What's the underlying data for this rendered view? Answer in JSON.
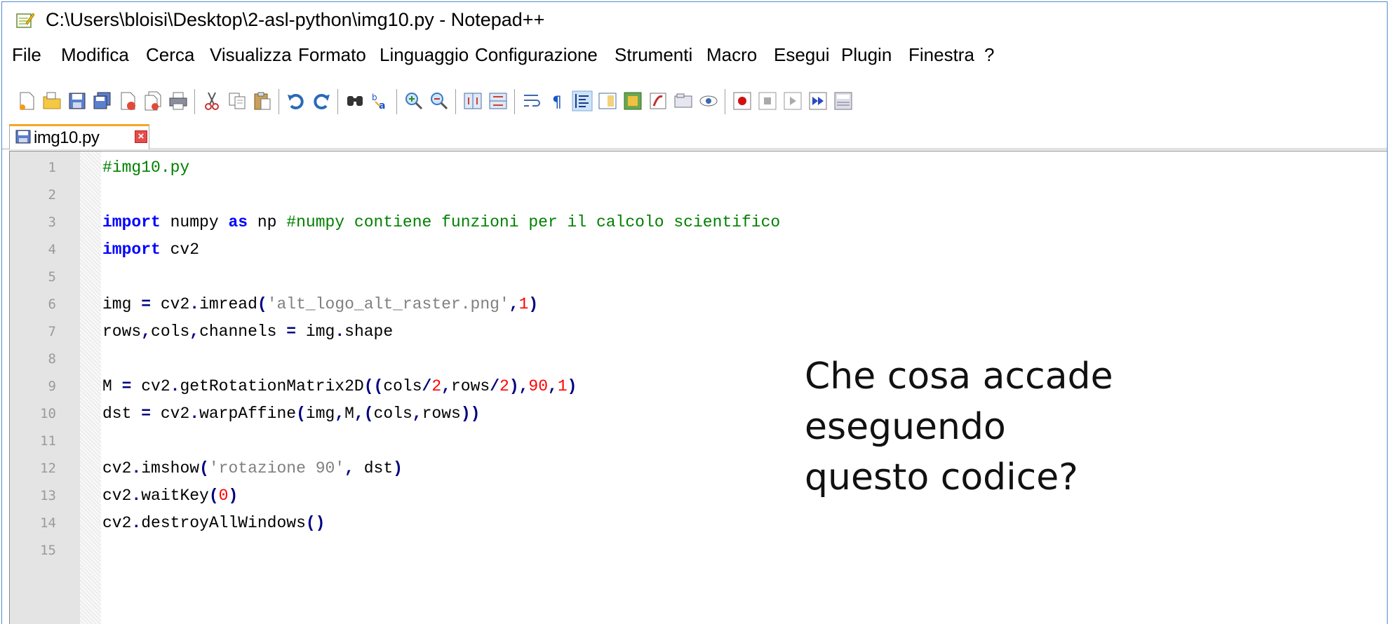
{
  "window": {
    "title": "C:\\Users\\bloisi\\Desktop\\2-asl-python\\img10.py - Notepad++"
  },
  "menu": [
    "File",
    "Modifica",
    "Cerca",
    "Visualizza",
    "Formato",
    "Linguaggio",
    "Configurazione",
    "Strumenti",
    "Macro",
    "Esegui",
    "Plugin",
    "Finestra",
    "?"
  ],
  "toolbar_icons": [
    "new-file-icon",
    "open-file-icon",
    "save-icon",
    "save-all-icon",
    "close-icon",
    "close-all-icon",
    "print-icon",
    "cut-icon",
    "copy-icon",
    "paste-icon",
    "undo-icon",
    "redo-icon",
    "find-icon",
    "replace-icon",
    "zoom-in-icon",
    "zoom-out-icon",
    "sync-vertical-icon",
    "sync-horizontal-icon",
    "word-wrap-icon",
    "show-all-chars-icon",
    "indent-guide-icon",
    "document-map-icon",
    "function-list-icon",
    "folder-workspace-icon",
    "monitoring-icon",
    "record-macro-icon",
    "stop-record-icon",
    "play-macro-icon",
    "run-macro-multiple-icon",
    "save-macro-icon"
  ],
  "tab": {
    "label": "img10.py"
  },
  "editor": {
    "line_numbers": [
      "1",
      "2",
      "3",
      "4",
      "5",
      "6",
      "7",
      "8",
      "9",
      "10",
      "11",
      "12",
      "13",
      "14",
      "15"
    ],
    "lines": [
      [
        {
          "t": "#img10.py",
          "c": "cm"
        }
      ],
      [],
      [
        {
          "t": "import",
          "c": "kw"
        },
        {
          "t": " numpy ",
          "c": ""
        },
        {
          "t": "as",
          "c": "kw"
        },
        {
          "t": " np ",
          "c": ""
        },
        {
          "t": "#numpy contiene funzioni per il calcolo scientifico",
          "c": "cm"
        }
      ],
      [
        {
          "t": "import",
          "c": "kw"
        },
        {
          "t": " cv2",
          "c": ""
        }
      ],
      [],
      [
        {
          "t": "img ",
          "c": ""
        },
        {
          "t": "=",
          "c": "op"
        },
        {
          "t": " cv2",
          "c": ""
        },
        {
          "t": ".",
          "c": "op"
        },
        {
          "t": "imread",
          "c": ""
        },
        {
          "t": "(",
          "c": "op"
        },
        {
          "t": "'alt_logo_alt_raster.png'",
          "c": "st"
        },
        {
          "t": ",",
          "c": "op"
        },
        {
          "t": "1",
          "c": "nm"
        },
        {
          "t": ")",
          "c": "op"
        }
      ],
      [
        {
          "t": "rows",
          "c": ""
        },
        {
          "t": ",",
          "c": "op"
        },
        {
          "t": "cols",
          "c": ""
        },
        {
          "t": ",",
          "c": "op"
        },
        {
          "t": "channels ",
          "c": ""
        },
        {
          "t": "=",
          "c": "op"
        },
        {
          "t": " img",
          "c": ""
        },
        {
          "t": ".",
          "c": "op"
        },
        {
          "t": "shape",
          "c": ""
        }
      ],
      [],
      [
        {
          "t": "M ",
          "c": ""
        },
        {
          "t": "=",
          "c": "op"
        },
        {
          "t": " cv2",
          "c": ""
        },
        {
          "t": ".",
          "c": "op"
        },
        {
          "t": "getRotationMatrix2D",
          "c": ""
        },
        {
          "t": "((",
          "c": "op"
        },
        {
          "t": "cols",
          "c": ""
        },
        {
          "t": "/",
          "c": "op"
        },
        {
          "t": "2",
          "c": "nm"
        },
        {
          "t": ",",
          "c": "op"
        },
        {
          "t": "rows",
          "c": ""
        },
        {
          "t": "/",
          "c": "op"
        },
        {
          "t": "2",
          "c": "nm"
        },
        {
          "t": "),",
          "c": "op"
        },
        {
          "t": "90",
          "c": "nm"
        },
        {
          "t": ",",
          "c": "op"
        },
        {
          "t": "1",
          "c": "nm"
        },
        {
          "t": ")",
          "c": "op"
        }
      ],
      [
        {
          "t": "dst ",
          "c": ""
        },
        {
          "t": "=",
          "c": "op"
        },
        {
          "t": " cv2",
          "c": ""
        },
        {
          "t": ".",
          "c": "op"
        },
        {
          "t": "warpAffine",
          "c": ""
        },
        {
          "t": "(",
          "c": "op"
        },
        {
          "t": "img",
          "c": ""
        },
        {
          "t": ",",
          "c": "op"
        },
        {
          "t": "M",
          "c": ""
        },
        {
          "t": ",",
          "c": "op"
        },
        {
          "t": "(",
          "c": "op"
        },
        {
          "t": "cols",
          "c": ""
        },
        {
          "t": ",",
          "c": "op"
        },
        {
          "t": "rows",
          "c": ""
        },
        {
          "t": "))",
          "c": "op"
        }
      ],
      [],
      [
        {
          "t": "cv2",
          "c": ""
        },
        {
          "t": ".",
          "c": "op"
        },
        {
          "t": "imshow",
          "c": ""
        },
        {
          "t": "(",
          "c": "op"
        },
        {
          "t": "'rotazione 90'",
          "c": "st"
        },
        {
          "t": ",",
          "c": "op"
        },
        {
          "t": " dst",
          "c": ""
        },
        {
          "t": ")",
          "c": "op"
        }
      ],
      [
        {
          "t": "cv2",
          "c": ""
        },
        {
          "t": ".",
          "c": "op"
        },
        {
          "t": "waitKey",
          "c": ""
        },
        {
          "t": "(",
          "c": "op"
        },
        {
          "t": "0",
          "c": "nm"
        },
        {
          "t": ")",
          "c": "op"
        }
      ],
      [
        {
          "t": "cv2",
          "c": ""
        },
        {
          "t": ".",
          "c": "op"
        },
        {
          "t": "destroyAllWindows",
          "c": ""
        },
        {
          "t": "()",
          "c": "op"
        }
      ],
      []
    ]
  },
  "overlay": {
    "line1": "Che cosa accade",
    "line2": "eseguendo",
    "line3": "questo codice?"
  }
}
